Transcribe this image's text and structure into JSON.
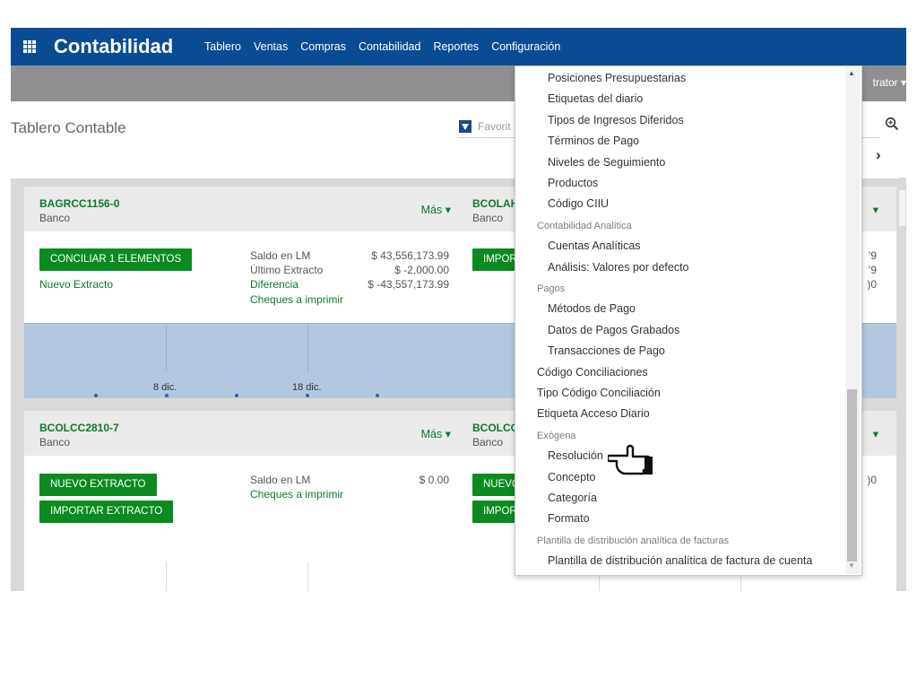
{
  "app": {
    "name": "Contabilidad"
  },
  "navbar": {
    "menu": [
      "Tablero",
      "Ventas",
      "Compras",
      "Contabilidad",
      "Reportes",
      "Configuración"
    ]
  },
  "user_menu": {
    "label": "trator ▾"
  },
  "control_panel": {
    "title": "Tablero Contable",
    "search_placeholder": "Favorit"
  },
  "cards": [
    {
      "name": "BAGRCC1156-0",
      "type": "Banco",
      "more": "Más ▾",
      "buttons": [
        "CONCILIAR 1 ELEMENTOS"
      ],
      "link": "Nuevo Extracto",
      "stats": [
        {
          "label": "Saldo en LM",
          "value": "$ 43,556,173.99"
        },
        {
          "label": "Último Extracto",
          "value": "$ -2,000.00"
        },
        {
          "label": "Diferencia",
          "value": "$ -43,557,173.99"
        }
      ],
      "checks_link": "Cheques a imprimir",
      "graph_ticks": [
        "8 dic.",
        "18 dic."
      ]
    },
    {
      "name": "BCOLAH",
      "type": "Banco",
      "buttons": [
        "IMPOR"
      ],
      "partial_values": [
        "'9",
        "'9",
        ")0"
      ]
    },
    {
      "name": "BCOLCC2810-7",
      "type": "Banco",
      "more": "Más ▾",
      "buttons": [
        "NUEVO EXTRACTO",
        "IMPORTAR EXTRACTO"
      ],
      "stats": [
        {
          "label": "Saldo en LM",
          "value": "$ 0.00"
        }
      ],
      "checks_link": "Cheques a imprimir"
    },
    {
      "name": "BCOLCC",
      "type": "Banco",
      "buttons": [
        "NUEVO",
        "IMPOR"
      ],
      "partial_values": [
        ")0"
      ]
    }
  ],
  "dropdown": {
    "items": [
      {
        "kind": "item",
        "label": "Posiciones Presupuestarias"
      },
      {
        "kind": "item",
        "label": "Etiquetas del diario"
      },
      {
        "kind": "item",
        "label": "Tipos de Ingresos Diferidos"
      },
      {
        "kind": "item",
        "label": "Términos de Pago"
      },
      {
        "kind": "item",
        "label": "Niveles de Seguimiento"
      },
      {
        "kind": "item",
        "label": "Productos"
      },
      {
        "kind": "item",
        "label": "Código CIIU"
      },
      {
        "kind": "header",
        "label": "Contabilidad Analítica"
      },
      {
        "kind": "item",
        "label": "Cuentas Analíticas"
      },
      {
        "kind": "item",
        "label": "Análisis: Valores por defecto"
      },
      {
        "kind": "header",
        "label": "Pagos"
      },
      {
        "kind": "item",
        "label": "Métodos de Pago"
      },
      {
        "kind": "item",
        "label": "Datos de Pagos Grabados"
      },
      {
        "kind": "item",
        "label": "Transacciones de Pago"
      },
      {
        "kind": "top",
        "label": "Código Conciliaciones"
      },
      {
        "kind": "top",
        "label": "Tipo Código Conciliación"
      },
      {
        "kind": "top",
        "label": "Etiqueta Acceso Diario"
      },
      {
        "kind": "header",
        "label": "Exógena"
      },
      {
        "kind": "item",
        "label": "Resolución"
      },
      {
        "kind": "item",
        "label": "Concepto"
      },
      {
        "kind": "item",
        "label": "Categoría"
      },
      {
        "kind": "item",
        "label": "Formato"
      },
      {
        "kind": "header",
        "label": "Plantilla de distribución analítica de facturas"
      },
      {
        "kind": "item",
        "label": "Plantilla de distribución analítica de factura de cuenta"
      }
    ]
  },
  "colors": {
    "navbar": "#0a4c94",
    "accent_green": "#0b8b1f",
    "graph": "#b3c7df"
  },
  "icons": [
    "apps-grid-icon",
    "filter-icon",
    "search-icon",
    "chevron-right-icon",
    "hand-pointer-icon",
    "caret-down-icon"
  ]
}
